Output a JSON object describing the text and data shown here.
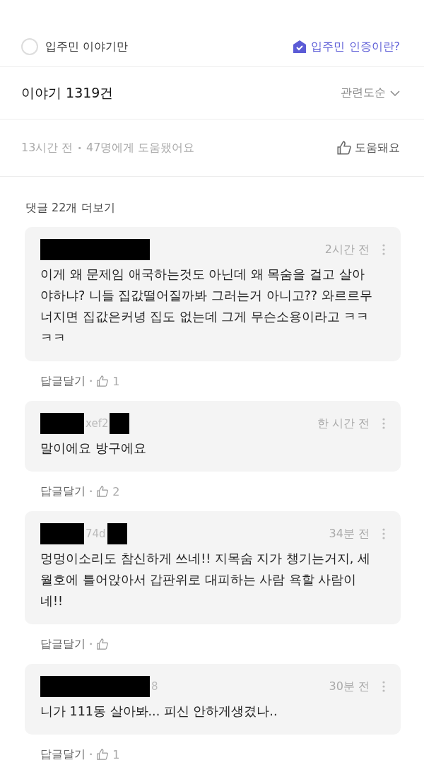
{
  "filter": {
    "label": "입주민 이야기만",
    "checked": false
  },
  "verify_link": "입주민 인증이란?",
  "header": {
    "title": "이야기 1319건",
    "sort": "관련도순"
  },
  "post_meta": {
    "time": "13시간 전",
    "separator": "•",
    "helpful": "47명에게 도움됐어요",
    "helpful_button": "도움돼요"
  },
  "more_comments": "댓글 22개 더보기",
  "comments": [
    {
      "author": [
        {
          "kind": "bar"
        }
      ],
      "time": "2시간 전",
      "text": "이게 왜 문제임 애국하는것도 아닌데 왜 목숨을 걸고 살아야하냐? 니들 집값떨어질까봐 그러는거 아니고?? 와르르무너지면 집값은커녕 집도 없는데 그게 무슨소용이라고 ㅋㅋㅋㅋ",
      "reply": "답글달기",
      "likes": "1"
    },
    {
      "author": [
        {
          "kind": "block"
        },
        {
          "kind": "text",
          "text": "xef2"
        },
        {
          "kind": "square"
        }
      ],
      "time": "한 시간 전",
      "text": "말이에요 방구에요",
      "reply": "답글달기",
      "likes": "2"
    },
    {
      "author": [
        {
          "kind": "block"
        },
        {
          "kind": "text",
          "text": "74d"
        },
        {
          "kind": "square"
        }
      ],
      "time": "34분 전",
      "text": "멍멍이소리도 참신하게 쓰네!! 지목숨 지가 챙기는거지, 세월호에 틀어앉아서 갑판위로 대피하는 사람 욕할 사람이네!!",
      "reply": "답글달기"
    },
    {
      "author": [
        {
          "kind": "bar"
        },
        {
          "kind": "text",
          "text": "8"
        }
      ],
      "time": "30분 전",
      "text": "니가 111동 살아봐... 피신 안하게생겼나..",
      "reply": "답글달기",
      "likes": "1"
    }
  ]
}
